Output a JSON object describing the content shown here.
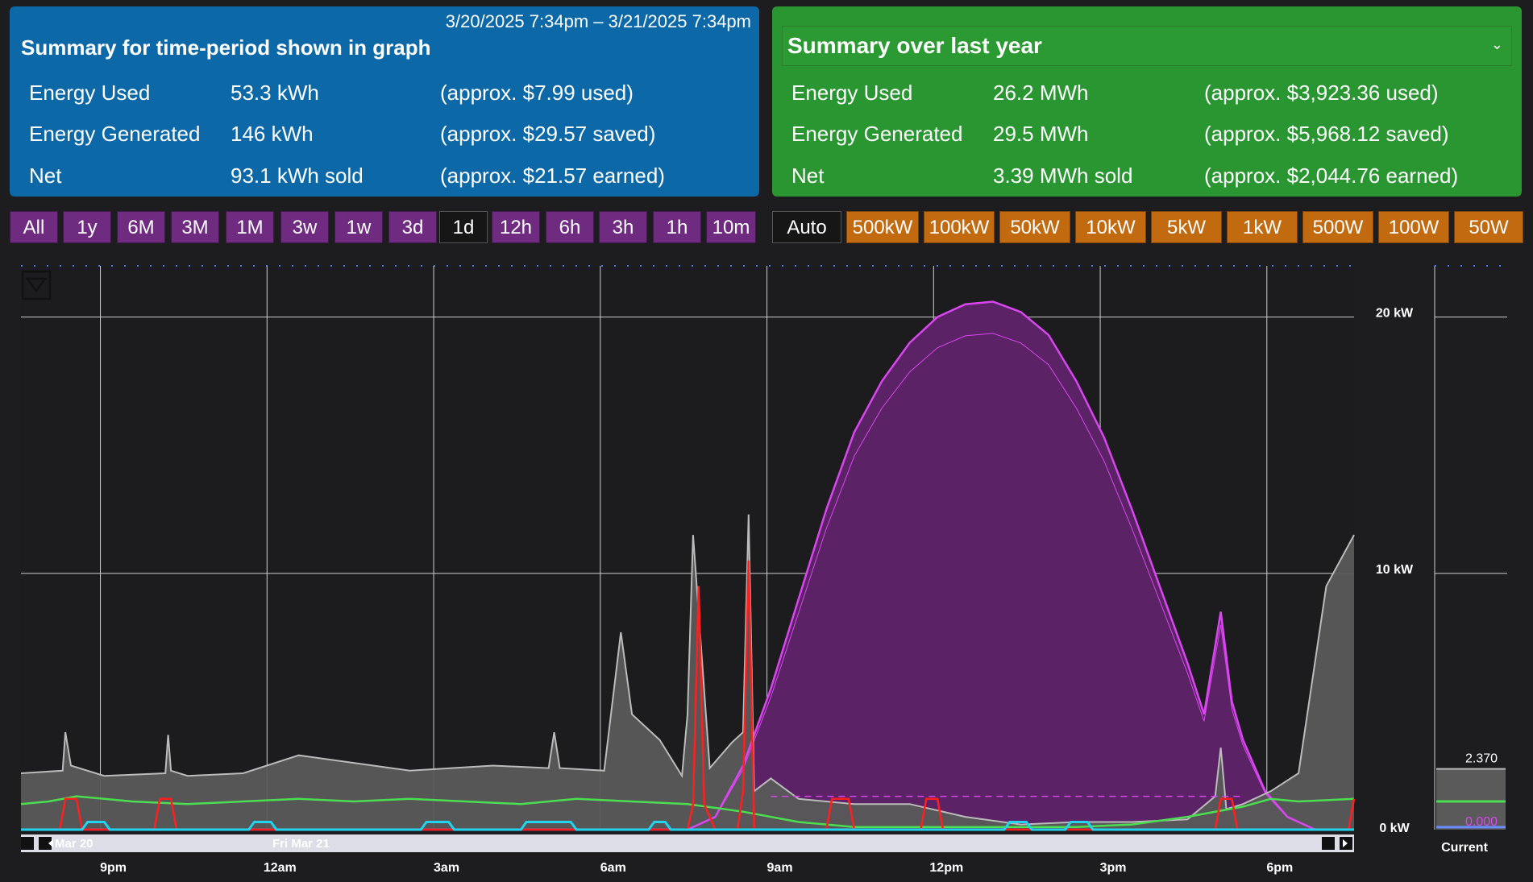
{
  "left_panel": {
    "range": "3/20/2025 7:34pm – 3/21/2025 7:34pm",
    "title": "Summary for time-period shown in graph",
    "rows": [
      {
        "label": "Energy Used",
        "value": "53.3 kWh",
        "cost": "(approx. $7.99 used)"
      },
      {
        "label": "Energy Generated",
        "value": "146 kWh",
        "cost": "(approx. $29.57 saved)"
      },
      {
        "label": "Net",
        "value": "93.1 kWh sold",
        "cost": "(approx. $21.57 earned)"
      }
    ]
  },
  "right_panel": {
    "title": "Summary over last year",
    "rows": [
      {
        "label": "Energy Used",
        "value": "26.2 MWh",
        "cost": "(approx. $3,923.36 used)"
      },
      {
        "label": "Energy Generated",
        "value": "29.5 MWh",
        "cost": "(approx. $5,968.12 saved)"
      },
      {
        "label": "Net",
        "value": "3.39 MWh sold",
        "cost": "(approx. $2,044.76 earned)"
      }
    ]
  },
  "time_buttons": [
    "All",
    "1y",
    "6M",
    "3M",
    "1M",
    "3w",
    "1w",
    "3d",
    "1d",
    "12h",
    "6h",
    "3h",
    "1h",
    "10m"
  ],
  "time_active": "1d",
  "scale_buttons": [
    "Auto",
    "500kW",
    "100kW",
    "50kW",
    "10kW",
    "5kW",
    "1kW",
    "500W",
    "100W",
    "50W"
  ],
  "scale_active": "Auto",
  "colors": {
    "generated": "#d946ef",
    "generated_fill": "#5b2266",
    "used": "#bbbbbb",
    "used_fill": "#5a5a5a",
    "green_line": "#4ade50",
    "red_line": "#ff1f1f",
    "cyan_line": "#22d3ee"
  },
  "chart_data": {
    "type": "area",
    "ylim": [
      0,
      22
    ],
    "y_ticks": [
      {
        "value": 20,
        "label": "20 kW"
      },
      {
        "value": 10,
        "label": "10 kW"
      },
      {
        "value": 0,
        "label": "0 kW"
      }
    ],
    "x_tick_labels": [
      "9pm",
      "12am",
      "3am",
      "6am",
      "9am",
      "12pm",
      "3pm",
      "6pm"
    ],
    "x_hours": [
      1.43,
      4.43,
      7.43,
      10.43,
      13.43,
      16.43,
      19.43,
      22.43
    ],
    "navigator_labels": [
      "Mar 20",
      "Fri Mar 21"
    ],
    "series": [
      {
        "name": "generated",
        "x": [
          0,
          12,
          12.5,
          13,
          13.5,
          14,
          14.5,
          15,
          15.5,
          16,
          16.5,
          17,
          17.5,
          18,
          18.5,
          19,
          19.5,
          20,
          20.5,
          21,
          21.3,
          21.6,
          21.8,
          22,
          22.4,
          22.8,
          23.3,
          24
        ],
        "values": [
          0,
          0,
          0.5,
          2.5,
          5.5,
          9,
          12.5,
          15.5,
          17.5,
          19,
          20,
          20.5,
          20.6,
          20.2,
          19.3,
          17.5,
          15.3,
          12.5,
          9.5,
          6.5,
          4.5,
          8.5,
          5,
          3.5,
          1.5,
          0.5,
          0,
          0
        ]
      },
      {
        "name": "used",
        "x": [
          0,
          0.75,
          0.8,
          0.9,
          1.5,
          2.6,
          2.65,
          2.7,
          3,
          4,
          5,
          7,
          8.5,
          9.5,
          9.6,
          9.7,
          10.5,
          10.8,
          11,
          11.5,
          11.9,
          12,
          12.1,
          12.4,
          12.8,
          13,
          13.1,
          13.2,
          13.5,
          14,
          15,
          16,
          17,
          18,
          19,
          20,
          21,
          21.5,
          21.6,
          21.7,
          22,
          22.5,
          23,
          23.5,
          24
        ],
        "values": [
          2.2,
          2.3,
          3.8,
          2.5,
          2.1,
          2.2,
          3.7,
          2.3,
          2.1,
          2.2,
          2.9,
          2.3,
          2.5,
          2.4,
          3.8,
          2.4,
          2.3,
          7.7,
          4.5,
          3.5,
          2.1,
          4.5,
          11.5,
          2.4,
          3.4,
          3.8,
          12.3,
          1.5,
          2,
          1.2,
          1,
          1,
          0.5,
          0.2,
          0.3,
          0.3,
          0.4,
          1.3,
          3.2,
          0.8,
          1,
          1.5,
          2.2,
          9.5,
          11.5
        ]
      },
      {
        "name": "green",
        "x": [
          0,
          0.5,
          1,
          1.5,
          2,
          3,
          4,
          5,
          6,
          7,
          8,
          9,
          10,
          11,
          12,
          13,
          14,
          15,
          16,
          17,
          18,
          19,
          20,
          21,
          22,
          22.5,
          23,
          24
        ],
        "values": [
          1,
          1.1,
          1.3,
          1.2,
          1.1,
          1,
          1.1,
          1.2,
          1.1,
          1.2,
          1.1,
          1,
          1.2,
          1.1,
          1,
          0.7,
          0.3,
          0.1,
          0.1,
          0.1,
          0.1,
          0.1,
          0.2,
          0.5,
          0.9,
          1.2,
          1.1,
          1.2
        ]
      },
      {
        "name": "red",
        "x": [
          0,
          0.7,
          0.8,
          1,
          1.1,
          2.4,
          2.5,
          2.7,
          2.8,
          12,
          12.1,
          12.2,
          12.3,
          12.5,
          12.9,
          13,
          13.1,
          13.2,
          14,
          14.5,
          14.6,
          14.9,
          15,
          16.2,
          16.3,
          16.5,
          16.6,
          21.5,
          21.6,
          21.8,
          21.9,
          23.9,
          24
        ],
        "values": [
          0,
          0,
          1.2,
          1.2,
          0,
          0,
          1.2,
          1.2,
          0,
          0,
          1,
          9.5,
          1,
          0,
          0,
          1.5,
          10.5,
          0,
          0,
          0,
          1.2,
          1.2,
          0,
          0,
          1.2,
          1.2,
          0,
          0,
          1.2,
          1.2,
          0,
          0,
          1.2
        ]
      },
      {
        "name": "cyan",
        "x": [
          0,
          1.1,
          1.2,
          1.5,
          1.6,
          4.1,
          4.2,
          4.5,
          4.6,
          7.2,
          7.3,
          7.7,
          7.8,
          9,
          9.1,
          9.9,
          10,
          11.3,
          11.4,
          11.6,
          11.7,
          17.7,
          17.8,
          18.1,
          18.2,
          18.8,
          18.9,
          19.2,
          19.3,
          24
        ],
        "values": [
          0,
          0,
          0.3,
          0.3,
          0,
          0,
          0.3,
          0.3,
          0,
          0,
          0.3,
          0.3,
          0,
          0,
          0.3,
          0.3,
          0,
          0,
          0.3,
          0.3,
          0,
          0,
          0.3,
          0.3,
          0,
          0,
          0.3,
          0.3,
          0,
          0
        ]
      }
    ],
    "current": {
      "label": "Current",
      "used_value": "2.370",
      "generated_value": "0.000"
    }
  }
}
